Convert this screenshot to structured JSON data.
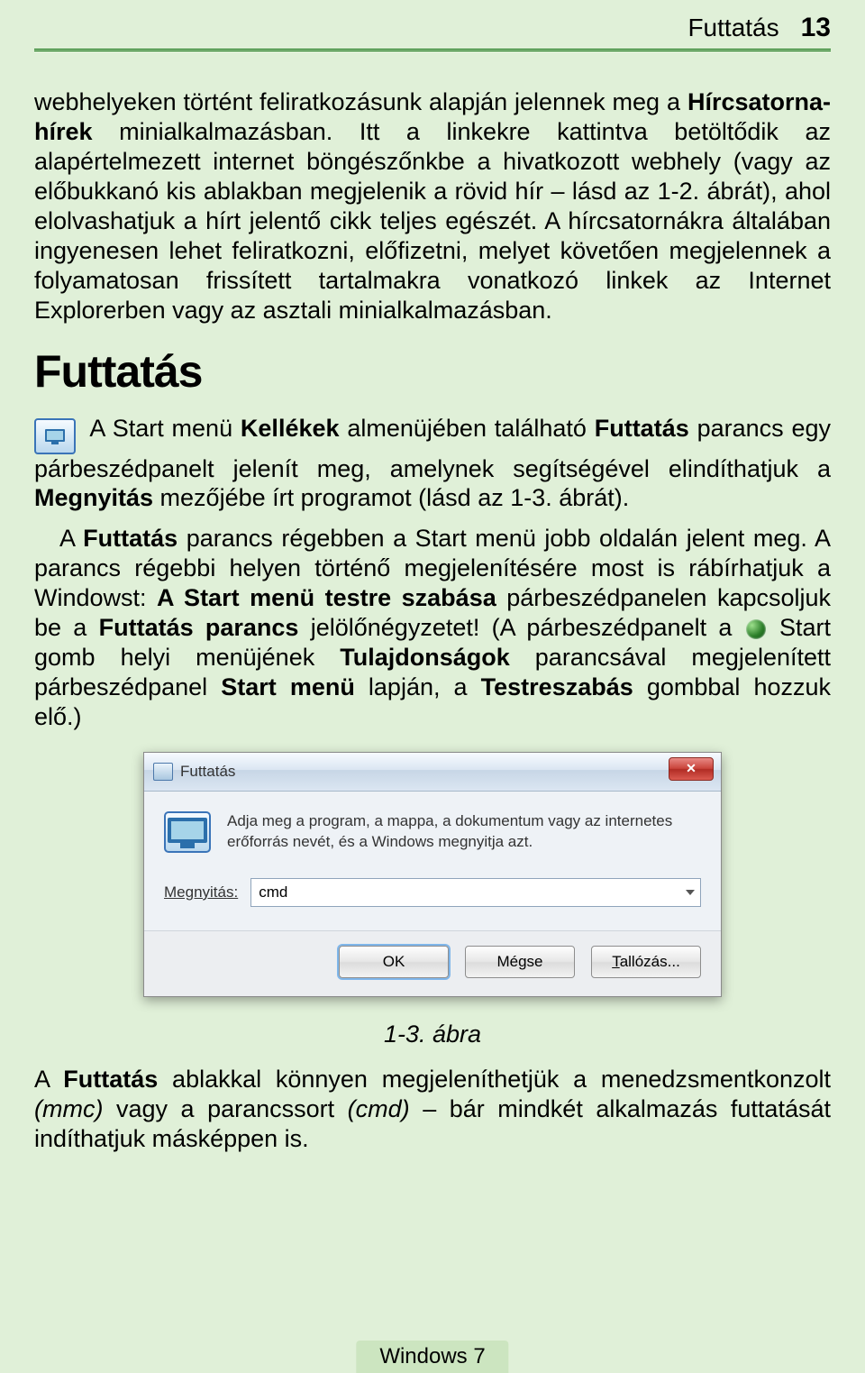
{
  "header": {
    "title": "Futtatás",
    "page_number": "13"
  },
  "para1": {
    "t1": "webhelyeken történt feliratkozásunk alapján jelennek meg a ",
    "b1": "Hírcsatorna-hírek",
    "t2": " minialkalmazásban. Itt a linkekre kattintva betöltődik az alapértelmezett internet böngészőnkbe a hivatkozott webhely (vagy az előbukkanó kis ablakban megjelenik a rövid hír – lásd az 1-2. ábrát), ahol elolvashatjuk a hírt jelentő cikk teljes egészét. A hírcsatornákra általában ingyenesen lehet feliratkozni, előfizetni, melyet követően megjelennek a folyamatosan frissített tartalmakra vonatkozó linkek az Internet Explorerben vagy az asztali minialkalmazásban."
  },
  "heading": "Futtatás",
  "para2": {
    "t1": "A Start menü ",
    "b1": "Kellékek",
    "t2": " almenüjében található ",
    "b2": "Futtatás",
    "t3": " parancs egy párbeszédpanelt jelenít meg, amelynek segítségével elindíthatjuk a ",
    "b3": "Megnyitás",
    "t4": " mezőjébe írt programot (lásd az 1-3. ábrát)."
  },
  "para3_a": "A ",
  "para3_b": "Futtatás",
  "para3_c": " parancs régebben a Start menü jobb oldalán jelent meg. A parancs régebbi helyen történő megjelenítésére most is rábírhatjuk a Windowst: ",
  "para3_d": "A Start menü testre szabása",
  "para3_e": " párbeszédpanelen kapcsoljuk be a ",
  "para3_f": "Futtatás parancs",
  "para3_g": " jelölőnégyzetet! (A párbeszédpanelt a ",
  "para3_h": " Start gomb helyi menüjének ",
  "para3_i": "Tulajdonságok",
  "para3_j": " parancsával megjelenített párbeszédpanel ",
  "para3_k": "Start menü",
  "para3_l": " lapján, a ",
  "para3_m": "Testreszabás",
  "para3_n": " gombbal hozzuk elő.)",
  "dialog": {
    "title": "Futtatás",
    "description": "Adja meg a program, a mappa, a dokumentum vagy az internetes erőforrás nevét, és a Windows megnyitja azt.",
    "open_label": "Megnyitás:",
    "open_value": "cmd",
    "buttons": {
      "ok": "OK",
      "cancel": "Mégse",
      "browse": "Tallózás..."
    }
  },
  "caption": "1-3. ábra",
  "para4": {
    "t1": "A ",
    "b1": "Futtatás",
    "t2": " ablakkal könnyen megjeleníthetjük a menedzsmentkonzolt ",
    "i1": "(mmc)",
    "t3": " vagy a parancssort ",
    "i2": "(cmd)",
    "t4": " – bár mindkét alkalmazás futtatását indíthatjuk másképpen is."
  },
  "footer": "Windows 7"
}
